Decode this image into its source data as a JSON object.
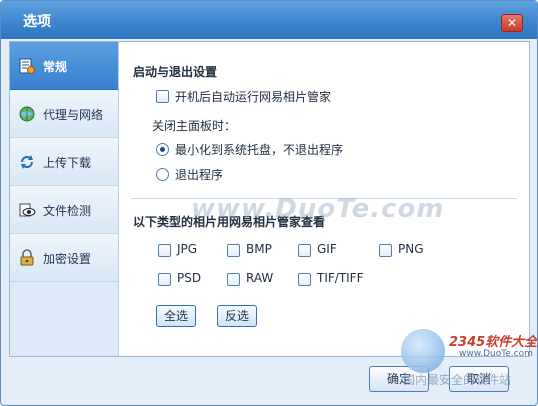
{
  "window": {
    "title": "选项",
    "close_glyph": "✕"
  },
  "sidebar": {
    "items": [
      {
        "label": "常规",
        "icon": "settings-icon",
        "active": true
      },
      {
        "label": "代理与网络",
        "icon": "globe-icon",
        "active": false
      },
      {
        "label": "上传下载",
        "icon": "sync-icon",
        "active": false
      },
      {
        "label": "文件检测",
        "icon": "eye-icon",
        "active": false
      },
      {
        "label": "加密设置",
        "icon": "lock-icon",
        "active": false
      }
    ]
  },
  "general": {
    "startup_section_title": "启动与退出设置",
    "autostart_label": "开机后自动运行网易相片管家",
    "autostart_checked": false,
    "close_panel_label": "关闭主面板时：",
    "minimize_label": "最小化到系统托盘，不退出程序",
    "exit_label": "退出程序",
    "selected_close_action": "minimize",
    "filetype_section_title": "以下类型的相片用网易相片管家查看",
    "filetypes": [
      {
        "label": "JPG",
        "checked": false
      },
      {
        "label": "BMP",
        "checked": false
      },
      {
        "label": "GIF",
        "checked": false
      },
      {
        "label": "PNG",
        "checked": false
      },
      {
        "label": "PSD",
        "checked": false
      },
      {
        "label": "RAW",
        "checked": false
      },
      {
        "label": "TIF/TIFF",
        "checked": false
      }
    ],
    "select_all_label": "全选",
    "invert_label": "反选"
  },
  "footer": {
    "ok_label": "确定",
    "cancel_label": "取消"
  },
  "watermark": {
    "text": "www.DuoTe.com"
  },
  "corner_logo": {
    "brand": "2345软件大全",
    "url": "www.DuoTe.com",
    "tagline": "国内最安全的软件站"
  },
  "colors": {
    "accent": "#3f86d0",
    "close": "#c9392c",
    "title_text": "#ffffff"
  }
}
